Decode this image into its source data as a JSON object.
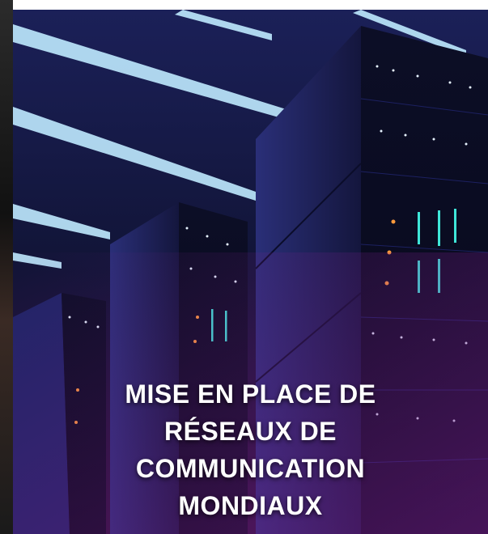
{
  "caption": {
    "lines": [
      "MISE EN PLACE DE",
      "RÉSEAUX DE",
      "COMMUNICATION",
      "MONDIAUX"
    ]
  },
  "colors": {
    "background": "#0d0f2e",
    "ceiling_light": "#bfeaff",
    "rack": "#14163d",
    "glow": "#7a1e8c",
    "caption_text": "#ffffff"
  }
}
